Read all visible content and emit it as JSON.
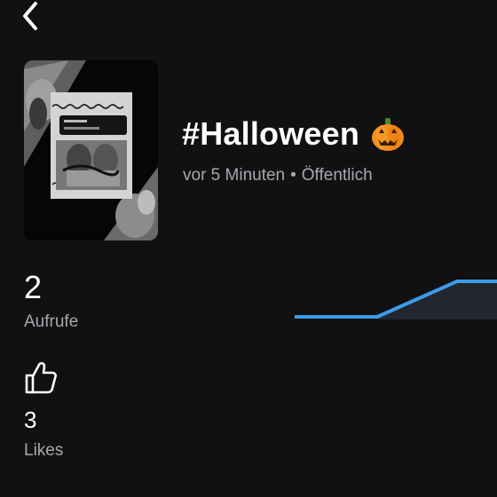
{
  "header": {
    "back_icon": "chevron-left-icon"
  },
  "video": {
    "title": "#Halloween",
    "title_emoji": "pumpkin-icon",
    "time_ago": "vor 5 Minuten",
    "separator": "•",
    "visibility": "Öffentlich"
  },
  "stats": {
    "views": {
      "value": "2",
      "label": "Aufrufe"
    },
    "likes": {
      "value": "3",
      "label": "Likes",
      "icon": "thumbs-up-icon"
    }
  },
  "colors": {
    "background": "#111113",
    "accent_line": "#3d9be9",
    "secondary_text": "#a8a8ad"
  }
}
